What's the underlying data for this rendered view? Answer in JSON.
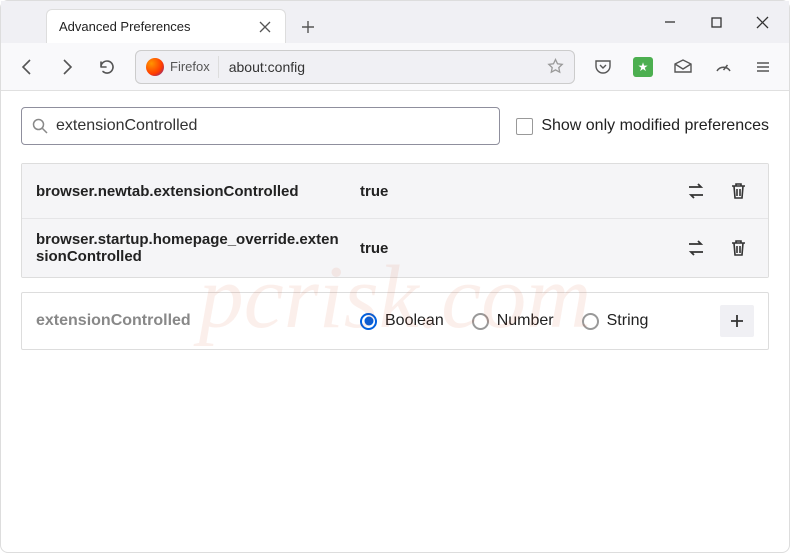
{
  "window": {
    "tab_title": "Advanced Preferences"
  },
  "urlbar": {
    "identity_label": "Firefox",
    "url": "about:config"
  },
  "search": {
    "value": "extensionControlled",
    "checkbox_label": "Show only modified preferences"
  },
  "prefs": [
    {
      "name": "browser.newtab.extensionControlled",
      "value": "true"
    },
    {
      "name": "browser.startup.homepage_override.extensionControlled",
      "value": "true"
    }
  ],
  "create": {
    "name": "extensionControlled",
    "types": [
      {
        "label": "Boolean",
        "selected": true
      },
      {
        "label": "Number",
        "selected": false
      },
      {
        "label": "String",
        "selected": false
      }
    ]
  },
  "watermark": "pcrisk.com",
  "colors": {
    "accent": "#0060df"
  }
}
